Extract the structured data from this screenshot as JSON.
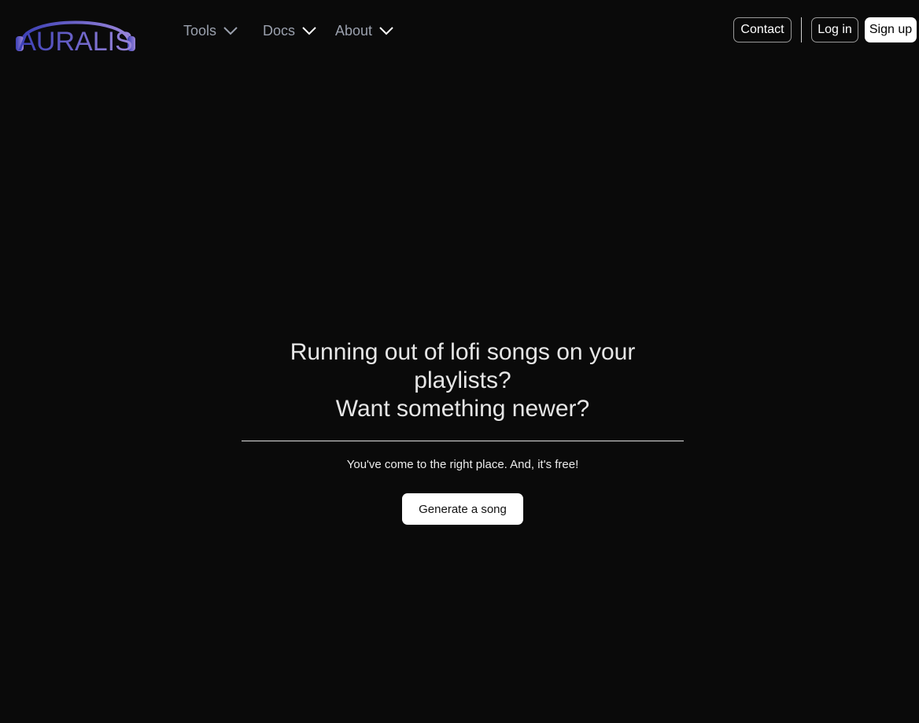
{
  "brand": {
    "logo_text": "AURALIS",
    "logo_gradient_start": "#3b3fb5",
    "logo_gradient_end": "#8b7fd6"
  },
  "nav": {
    "items": [
      {
        "label": "Tools",
        "icon": "chevron-down-icon"
      },
      {
        "label": "Docs",
        "icon": "chevron-down-icon"
      },
      {
        "label": "About",
        "icon": "chevron-down-icon"
      }
    ]
  },
  "actions": {
    "contact_label": "Contact",
    "login_label": "Log in",
    "signup_label": "Sign up"
  },
  "hero": {
    "headline_line1": "Running out of lofi songs on your playlists?",
    "headline_line2": "Want something newer?",
    "subtext": "You've come to the right place. And, it's free!",
    "cta_label": "Generate a song"
  },
  "colors": {
    "background": "#0a0a0a",
    "nav_text": "#9aa0ad",
    "button_fill": "#ffffff"
  }
}
